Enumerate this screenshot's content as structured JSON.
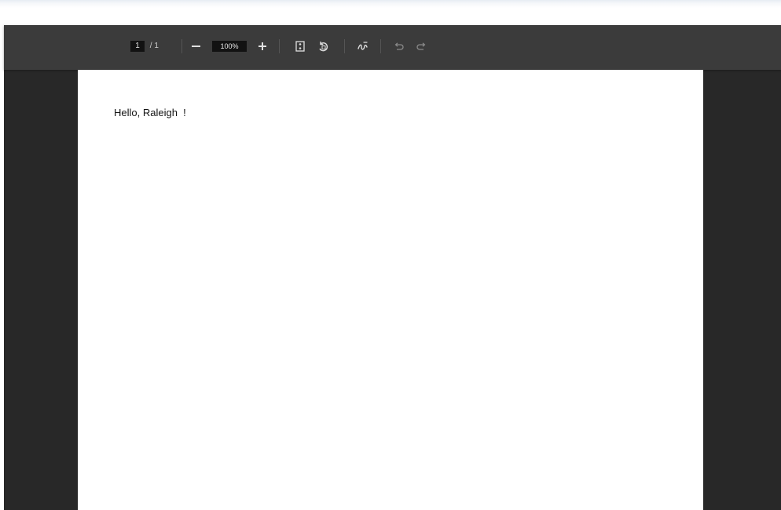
{
  "toolbar": {
    "current_page": "1",
    "page_separator": " / 1",
    "zoom_value": "100%",
    "icons": [
      "zoom-out-icon",
      "zoom-in-icon",
      "fit-page-icon",
      "rotate-icon",
      "annotate-icon",
      "undo-icon",
      "redo-icon"
    ]
  },
  "document": {
    "text": "Hello, Raleigh  !"
  },
  "colors": {
    "toolbar_bg": "#3b3b3b",
    "viewer_bg": "#282828",
    "page_bg": "#ffffff"
  }
}
